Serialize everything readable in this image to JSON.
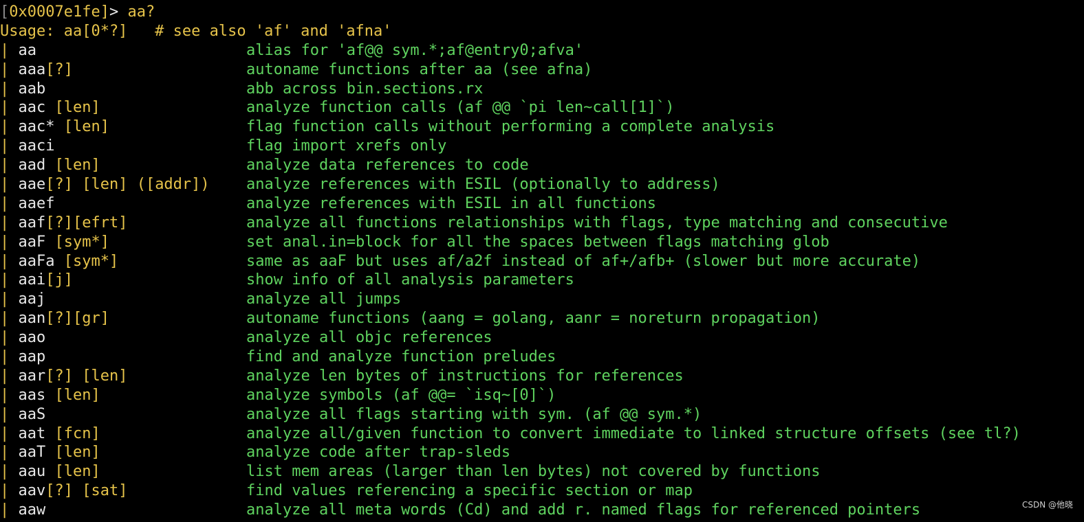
{
  "prompt": {
    "bracket_open": "[",
    "address": "0x0007e1fe",
    "bracket_close": "]",
    "arrow": "> ",
    "command": "aa?"
  },
  "usage": {
    "text": "Usage: aa[0*?]   # see also 'af' and 'afna'"
  },
  "rows": [
    {
      "cmd": "aa",
      "args": "",
      "desc": "alias for 'af@@ sym.*;af@entry0;afva'"
    },
    {
      "cmd": "aaa",
      "args": "[?]",
      "desc": "autoname functions after aa (see afna)"
    },
    {
      "cmd": "aab",
      "args": "",
      "desc": "abb across bin.sections.rx"
    },
    {
      "cmd": "aac",
      "args": " [len]",
      "desc": "analyze function calls (af @@ `pi len~call[1]`)"
    },
    {
      "cmd": "aac*",
      "args": " [len]",
      "desc": "flag function calls without performing a complete analysis"
    },
    {
      "cmd": "aaci",
      "args": "",
      "desc": "flag import xrefs only"
    },
    {
      "cmd": "aad",
      "args": " [len]",
      "desc": "analyze data references to code"
    },
    {
      "cmd": "aae",
      "args": "[?] [len] ([addr])",
      "desc": "analyze references with ESIL (optionally to address)"
    },
    {
      "cmd": "aaef",
      "args": "",
      "desc": "analyze references with ESIL in all functions"
    },
    {
      "cmd": "aaf",
      "args": "[?][efrt]",
      "desc": "analyze all functions relationships with flags, type matching and consecutive"
    },
    {
      "cmd": "aaF",
      "args": " [sym*]",
      "desc": "set anal.in=block for all the spaces between flags matching glob"
    },
    {
      "cmd": "aaFa",
      "args": " [sym*]",
      "desc": "same as aaF but uses af/a2f instead of af+/afb+ (slower but more accurate)"
    },
    {
      "cmd": "aai",
      "args": "[j]",
      "desc": "show info of all analysis parameters"
    },
    {
      "cmd": "aaj",
      "args": "",
      "desc": "analyze all jumps"
    },
    {
      "cmd": "aan",
      "args": "[?][gr]",
      "desc": "autoname functions (aang = golang, aanr = noreturn propagation)"
    },
    {
      "cmd": "aao",
      "args": "",
      "desc": "analyze all objc references"
    },
    {
      "cmd": "aap",
      "args": "",
      "desc": "find and analyze function preludes"
    },
    {
      "cmd": "aar",
      "args": "[?] [len]",
      "desc": "analyze len bytes of instructions for references"
    },
    {
      "cmd": "aas",
      "args": " [len]",
      "desc": "analyze symbols (af @@= `isq~[0]`)"
    },
    {
      "cmd": "aaS",
      "args": "",
      "desc": "analyze all flags starting with sym. (af @@ sym.*)"
    },
    {
      "cmd": "aat",
      "args": " [fcn]",
      "desc": "analyze all/given function to convert immediate to linked structure offsets (see tl?)"
    },
    {
      "cmd": "aaT",
      "args": " [len]",
      "desc": "analyze code after trap-sleds"
    },
    {
      "cmd": "aau",
      "args": " [len]",
      "desc": "list mem areas (larger than len bytes) not covered by functions"
    },
    {
      "cmd": "aav",
      "args": "[?] [sat]",
      "desc": "find values referencing a specific section or map"
    },
    {
      "cmd": "aaw",
      "args": "",
      "desc": "analyze all meta words (Cd) and add r. named flags for referenced pointers"
    }
  ],
  "watermark": "CSDN @他晓",
  "colors": {
    "background": "#000000",
    "command": "#e8e8e8",
    "args": "#e6c34a",
    "description": "#5fd35f",
    "prompt_address": "#e6c34a",
    "bracket": "#8a8a8a"
  }
}
